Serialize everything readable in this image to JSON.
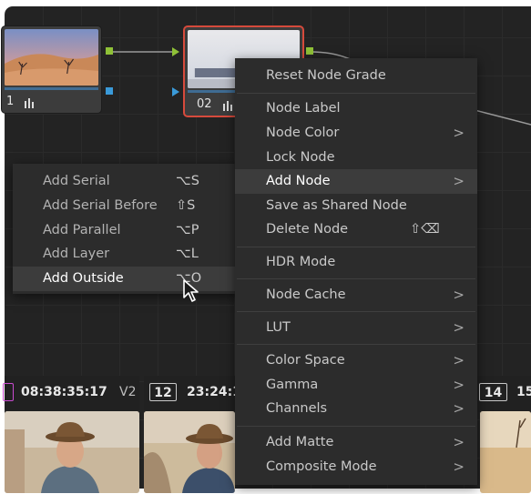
{
  "colors": {
    "editor_bg": "#232323",
    "menu_bg": "#2c2c2c",
    "menu_highlight": "#3c3c3c",
    "selected_node_border": "#d64a3c",
    "rgb_output_port": "#8fc137",
    "alpha_output_port": "#3a9ad9"
  },
  "node_graph": {
    "nodes": [
      {
        "label": "1",
        "icon": "histogram-icon",
        "selected": false
      },
      {
        "label": "02",
        "icon": "histogram-icon",
        "selected": true
      }
    ]
  },
  "context_menu": {
    "items": [
      {
        "label": "Reset Node Grade",
        "submenu": false
      },
      {
        "label": "Node Label",
        "submenu": false
      },
      {
        "label": "Node Color",
        "submenu": true
      },
      {
        "label": "Lock Node",
        "submenu": false
      },
      {
        "label": "Add Node",
        "submenu": true,
        "highlighted": true
      },
      {
        "label": "Save as Shared Node",
        "submenu": false
      },
      {
        "label": "Delete Node",
        "submenu": false,
        "shortcut": "⇧⌫"
      },
      {
        "label": "HDR Mode",
        "submenu": false
      },
      {
        "label": "Node Cache",
        "submenu": true
      },
      {
        "label": "LUT",
        "submenu": true
      },
      {
        "label": "Color Space",
        "submenu": true
      },
      {
        "label": "Gamma",
        "submenu": true
      },
      {
        "label": "Channels",
        "submenu": true
      },
      {
        "label": "Add Matte",
        "submenu": true
      },
      {
        "label": "Composite Mode",
        "submenu": true
      }
    ]
  },
  "add_node_submenu": {
    "items": [
      {
        "label": "Add Serial",
        "shortcut": "⌥S"
      },
      {
        "label": "Add Serial Before",
        "shortcut": "⇧S"
      },
      {
        "label": "Add Parallel",
        "shortcut": "⌥P"
      },
      {
        "label": "Add Layer",
        "shortcut": "⌥L"
      },
      {
        "label": "Add Outside",
        "shortcut": "⌥O",
        "highlighted": true
      }
    ]
  },
  "timeline": {
    "clips": [
      {
        "number": "",
        "timecode": "08:38:35:17",
        "track": "V2"
      },
      {
        "number": "12",
        "timecode": "23:24:1",
        "track": ""
      },
      {
        "number": "14",
        "timecode": "15",
        "track": ""
      }
    ]
  }
}
